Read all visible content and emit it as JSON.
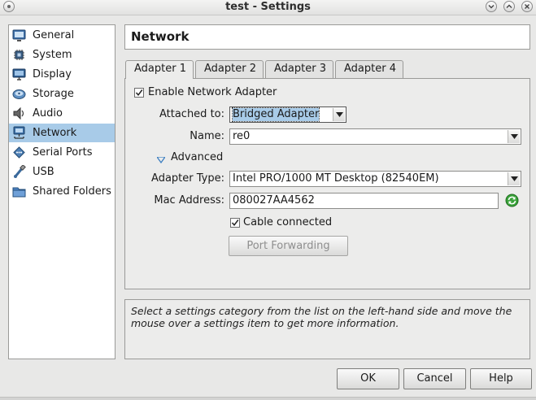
{
  "window": {
    "title": "test - Settings"
  },
  "sidebar": {
    "items": [
      {
        "label": "General",
        "icon": "general-icon"
      },
      {
        "label": "System",
        "icon": "system-chip-icon"
      },
      {
        "label": "Display",
        "icon": "display-monitor-icon"
      },
      {
        "label": "Storage",
        "icon": "storage-disk-icon"
      },
      {
        "label": "Audio",
        "icon": "audio-speaker-icon"
      },
      {
        "label": "Network",
        "icon": "network-icon",
        "selected": true
      },
      {
        "label": "Serial Ports",
        "icon": "serial-ports-icon"
      },
      {
        "label": "USB",
        "icon": "usb-icon"
      },
      {
        "label": "Shared Folders",
        "icon": "shared-folder-icon"
      }
    ]
  },
  "page": {
    "title": "Network"
  },
  "tabs": [
    {
      "label": "Adapter 1",
      "active": true
    },
    {
      "label": "Adapter 2"
    },
    {
      "label": "Adapter 3"
    },
    {
      "label": "Adapter 4"
    }
  ],
  "adapter": {
    "enable_label": "Enable Network Adapter",
    "enable_checked": true,
    "attached_label": "Attached to:",
    "attached_value": "Bridged Adapter",
    "name_label": "Name:",
    "name_value": "re0",
    "advanced_label": "Advanced",
    "advanced_expanded": true,
    "adapter_type_label": "Adapter Type:",
    "adapter_type_value": "Intel PRO/1000 MT Desktop (82540EM)",
    "mac_label": "Mac Address:",
    "mac_value": "080027AA4562",
    "cable_label": "Cable connected",
    "cable_checked": true,
    "port_forwarding_label": "Port Forwarding"
  },
  "info": {
    "text": "Select a settings category from the list on the left-hand side and move the mouse over a settings item to get more information."
  },
  "buttons": {
    "ok": "OK",
    "cancel": "Cancel",
    "help": "Help"
  },
  "colors": {
    "selection": "#a8cbe8",
    "window_bg": "#e8e8e7",
    "refresh_green": "#3aa33a"
  }
}
